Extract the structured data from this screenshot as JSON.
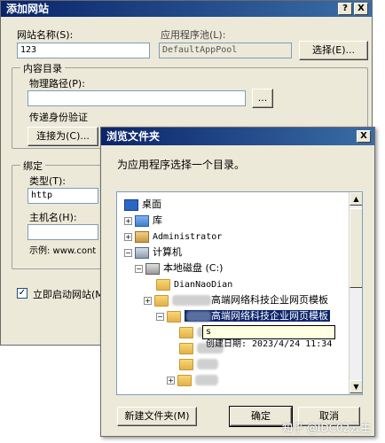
{
  "add_site": {
    "title": "添加网站",
    "help_btn": "?",
    "close_btn": "X",
    "site_name_label": "网站名称(S):",
    "site_name_value": "123",
    "app_pool_label": "应用程序池(L):",
    "app_pool_value": "DefaultAppPool",
    "select_btn": "选择(E)...",
    "content_dir_title": "内容目录",
    "physical_path_label": "物理路径(P):",
    "physical_path_value": "",
    "browse_btn": "...",
    "pass_auth_label": "传递身份验证",
    "connect_as_btn": "连接为(C)...",
    "binding_title": "绑定",
    "type_label": "类型(T):",
    "type_value": "http",
    "host_label": "主机名(H):",
    "host_value": "",
    "example_label": "示例: www.cont",
    "start_immediately_label": "立即启动网站(M"
  },
  "browse": {
    "title": "浏览文件夹",
    "close_btn": "X",
    "prompt": "为应用程序选择一个目录。",
    "tree": {
      "desktop": "桌面",
      "library": "库",
      "administrator": "Administrator",
      "computer": "计算机",
      "local_disk": "本地磁盘 (C:)",
      "diannaodian": "DianNaoDian",
      "template_folder": "高端网络科技企业网页模板",
      "template_selected": "高端网络科技企业网页模板",
      "plus": "+",
      "minus": "−"
    },
    "tooltip": "创建日期: 2023/4/24 11:34",
    "tooltip_prefix": "s",
    "new_folder_btn": "新建文件夹(M)",
    "ok_btn": "确定",
    "cancel_btn": "取消"
  },
  "watermark": "知乎 @IDC02云主"
}
